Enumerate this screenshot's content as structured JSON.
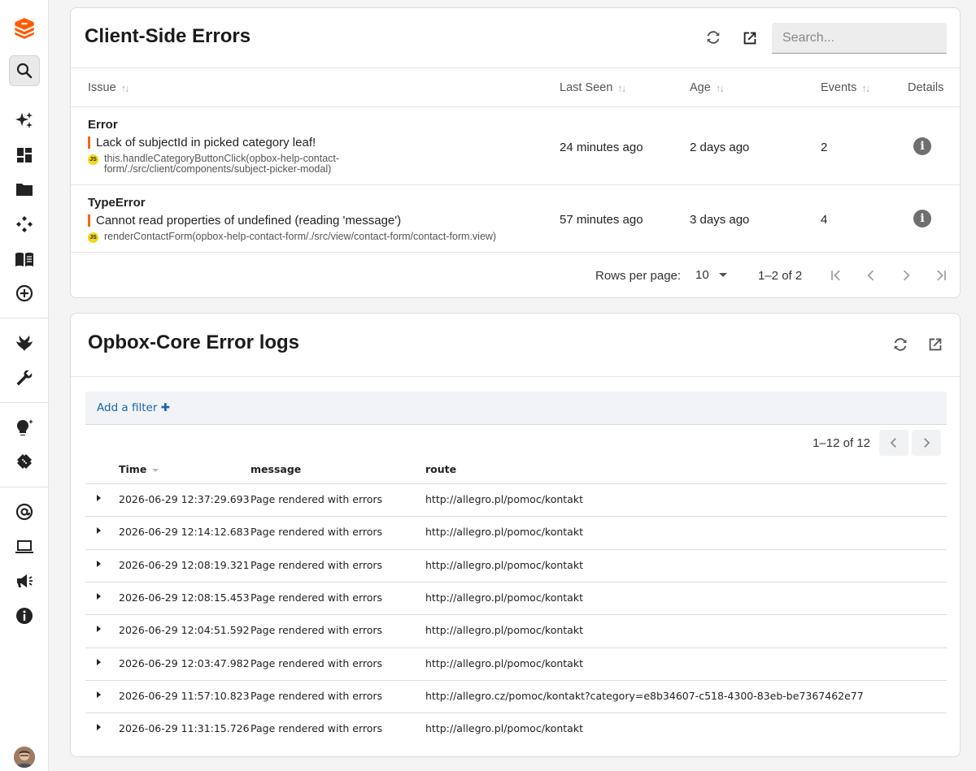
{
  "sidebar": {
    "logo": "allegro-box-logo",
    "items": [
      {
        "icon": "search-icon"
      },
      {
        "icon": "sparkles-icon"
      },
      {
        "icon": "dashboard-icon"
      },
      {
        "icon": "folder-icon"
      },
      {
        "icon": "components-icon"
      },
      {
        "icon": "book-icon"
      },
      {
        "icon": "add-circle-icon"
      },
      {
        "icon": "phoenix-icon"
      },
      {
        "icon": "wrench-icon"
      },
      {
        "icon": "lightbulb-icon"
      },
      {
        "icon": "bandage-icon"
      },
      {
        "icon": "at-sign-icon"
      },
      {
        "icon": "laptop-icon"
      },
      {
        "icon": "megaphone-icon"
      },
      {
        "icon": "info-icon"
      }
    ],
    "accent_color": "#ff5a00"
  },
  "client_errors": {
    "title": "Client-Side Errors",
    "search_placeholder": "Search...",
    "columns": {
      "issue": "Issue",
      "last_seen": "Last Seen",
      "age": "Age",
      "events": "Events",
      "details": "Details"
    },
    "rows": [
      {
        "type": "Error",
        "message": "Lack of subjectId in picked category leaf!",
        "stack_line1": "this.handleCategoryButtonClick(opbox-help-contact-",
        "stack_line2": "form/./src/client/components/subject-picker-modal)",
        "last_seen": "24 minutes ago",
        "age": "2 days ago",
        "events": "2"
      },
      {
        "type": "TypeError",
        "message": "Cannot read properties of undefined (reading 'message')",
        "stack_line1": "renderContactForm(opbox-help-contact-form/./src/view/contact-form/contact-form.view)",
        "stack_line2": "",
        "last_seen": "57 minutes ago",
        "age": "3 days ago",
        "events": "4"
      }
    ],
    "js_badge": "JS",
    "info_glyph": "i",
    "pagination": {
      "rows_per_page_label": "Rows per page:",
      "rows_per_page_value": "10",
      "range": "1–2 of 2"
    }
  },
  "core_logs": {
    "title": "Opbox-Core Error logs",
    "add_filter": "Add a filter",
    "add_filter_icon": "✚",
    "range": "1–12 of 12",
    "columns": {
      "time": "Time",
      "message": "message",
      "route": "route"
    },
    "rows": [
      {
        "time": "2026-06-29 12:37:29.693",
        "message": "Page rendered with errors",
        "route": "http://allegro.pl/pomoc/kontakt"
      },
      {
        "time": "2026-06-29 12:14:12.683",
        "message": "Page rendered with errors",
        "route": "http://allegro.pl/pomoc/kontakt"
      },
      {
        "time": "2026-06-29 12:08:19.321",
        "message": "Page rendered with errors",
        "route": "http://allegro.pl/pomoc/kontakt"
      },
      {
        "time": "2026-06-29 12:08:15.453",
        "message": "Page rendered with errors",
        "route": "http://allegro.pl/pomoc/kontakt"
      },
      {
        "time": "2026-06-29 12:04:51.592",
        "message": "Page rendered with errors",
        "route": "http://allegro.pl/pomoc/kontakt"
      },
      {
        "time": "2026-06-29 12:03:47.982",
        "message": "Page rendered with errors",
        "route": "http://allegro.pl/pomoc/kontakt"
      },
      {
        "time": "2026-06-29 11:57:10.823",
        "message": "Page rendered with errors",
        "route": "http://allegro.cz/pomoc/kontakt?category=e8b34607-c518-4300-83eb-be7367462e77"
      },
      {
        "time": "2026-06-29 11:31:15.726",
        "message": "Page rendered with errors",
        "route": "http://allegro.pl/pomoc/kontakt"
      }
    ]
  }
}
